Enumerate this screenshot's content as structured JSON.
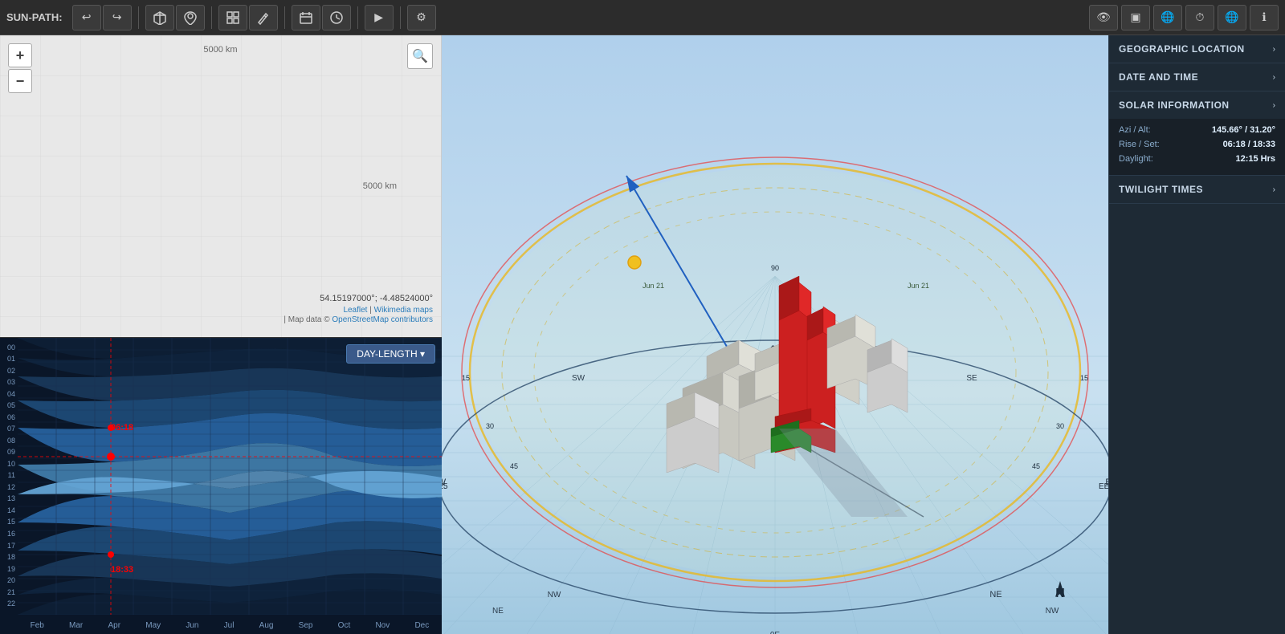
{
  "toolbar": {
    "label": "SUN-PATH:",
    "buttons": [
      "undo",
      "redo",
      "cube",
      "location",
      "grid",
      "edit",
      "calendar",
      "clock",
      "play",
      "settings"
    ],
    "right_buttons": [
      "eye",
      "layout",
      "globe1",
      "clock2",
      "globe2",
      "info"
    ]
  },
  "map": {
    "km_top": "5000 km",
    "km_right": "5000 km",
    "coord": "54.15197000°; -4.48524000°",
    "attribution": "Leaflet | Wikimedia maps",
    "attribution2": "| Map data © OpenStreetMap contributors"
  },
  "chart": {
    "day_length_label": "DAY-LENGTH ▾",
    "hours": [
      "00",
      "01",
      "02",
      "03",
      "04",
      "05",
      "06",
      "07",
      "08",
      "09",
      "10",
      "11",
      "12",
      "13",
      "14",
      "15",
      "16",
      "17",
      "18",
      "19",
      "20",
      "21",
      "22"
    ],
    "months": [
      "Feb",
      "Mar",
      "Apr",
      "May",
      "Jun",
      "Jul",
      "Aug",
      "Sep",
      "Oct",
      "Nov",
      "Dec"
    ],
    "markers": {
      "rise_time": "06:18",
      "set_time": "18:33",
      "current": "10"
    }
  },
  "sidebar": {
    "geo_location": {
      "title": "GEOGRAPHIC LOCATION",
      "expanded": false
    },
    "date_time": {
      "title": "DATE AND TIME",
      "expanded": false
    },
    "solar_info": {
      "title": "SOLAR INFORMATION",
      "expanded": true,
      "rows": [
        {
          "key": "Azi / Alt:",
          "value": "145.66° / 31.20°"
        },
        {
          "key": "Rise / Set:",
          "value": "06:18 / 18:33"
        },
        {
          "key": "Daylight:",
          "value": "12:15 Hrs"
        }
      ]
    },
    "twilight": {
      "title": "TWILIGHT TIMES",
      "expanded": false
    }
  }
}
